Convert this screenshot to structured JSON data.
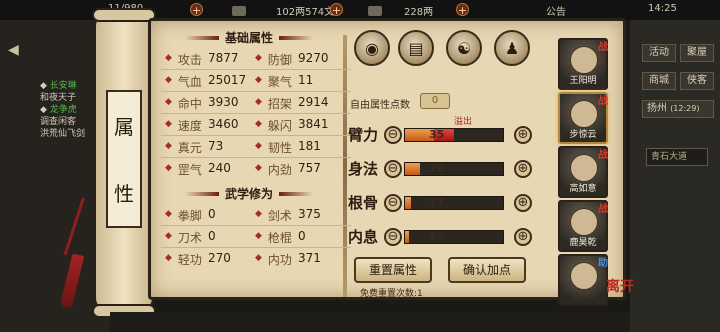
{
  "topbar": {
    "energy": "11/980",
    "silver": "102两574文",
    "gold": "228两",
    "announce": "公告",
    "time": "14:25"
  },
  "chat": [
    {
      "tag": "长安琳",
      "text": "和夜天子"
    },
    {
      "tag": "龙争虎",
      "text": "调查闲客"
    },
    {
      "tag": "",
      "text": "洪荒仙飞剑"
    }
  ],
  "right_side": {
    "buttons": [
      "活动",
      "聚屋",
      "商城",
      "侠客"
    ],
    "location": "扬州",
    "location_time": "(12:29)",
    "road": "青石大道"
  },
  "scroll_label": [
    "属",
    "性"
  ],
  "basic_title": "基础属性",
  "basic_stats": [
    {
      "label": "攻击",
      "value": "7877"
    },
    {
      "label": "防御",
      "value": "9270"
    },
    {
      "label": "气血",
      "value": "25017"
    },
    {
      "label": "聚气",
      "value": "11"
    },
    {
      "label": "命中",
      "value": "3930"
    },
    {
      "label": "招架",
      "value": "2914"
    },
    {
      "label": "速度",
      "value": "3460"
    },
    {
      "label": "躲闪",
      "value": "3841"
    },
    {
      "label": "真元",
      "value": "73"
    },
    {
      "label": "韧性",
      "value": "181"
    },
    {
      "label": "罡气",
      "value": "240"
    },
    {
      "label": "内劲",
      "value": "757"
    }
  ],
  "martial_title": "武学修为",
  "martial_stats": [
    {
      "label": "拳脚",
      "value": "0"
    },
    {
      "label": "剑术",
      "value": "375"
    },
    {
      "label": "刀术",
      "value": "0"
    },
    {
      "label": "枪棍",
      "value": "0"
    },
    {
      "label": "轻功",
      "value": "270"
    },
    {
      "label": "内功",
      "value": "371"
    }
  ],
  "hero_icons": [
    "hat-icon",
    "scroll-icon",
    "yin-yang-icon",
    "figure-icon"
  ],
  "free_points_label": "自由属性点数",
  "free_points": "0",
  "overflow_label": "溢出",
  "attributes": [
    {
      "name": "臂力",
      "value": "35",
      "fill": 0.3,
      "over": 0.2
    },
    {
      "name": "身法",
      "value": "76",
      "fill": 0.15,
      "over": 0
    },
    {
      "name": "根骨",
      "value": "27",
      "fill": 0.06,
      "over": 0
    },
    {
      "name": "内息",
      "value": "53",
      "fill": 0.04,
      "over": 0
    }
  ],
  "minus_glyph": "⊖",
  "plus_glyph": "⊕",
  "reset_button": "重置属性",
  "confirm_button": "确认加点",
  "reset_note": "免费重置次数:1",
  "characters": [
    {
      "name": "王阳明",
      "tag": "战"
    },
    {
      "name": "步惊云",
      "tag": "战"
    },
    {
      "name": "高如意",
      "tag": "战"
    },
    {
      "name": "鹿昊乾",
      "tag": "战"
    },
    {
      "name": "",
      "tag": "助"
    }
  ],
  "depart_label": "离开",
  "colors": {
    "accent_red": "#c0281e",
    "parchment": "#e7d7b2",
    "bar_fill": "#c05a1a"
  }
}
